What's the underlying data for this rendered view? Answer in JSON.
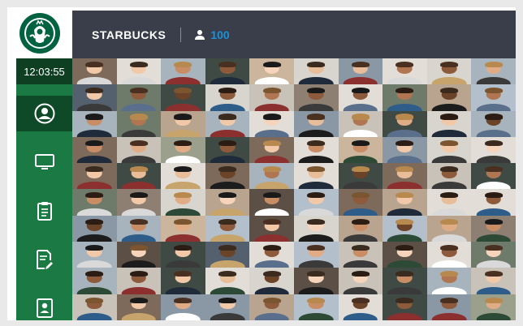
{
  "app": {
    "brand": "STARBUCKS",
    "participant_count": "100",
    "clock": "12:03:55"
  },
  "colors": {
    "sidebar": "#1b7a43",
    "sidebar_dark": "#0e3f23",
    "topbar": "#3a3d4a",
    "accent": "#1e90d6"
  },
  "sidebar": {
    "items": [
      {
        "icon": "user-circle-icon",
        "active": true
      },
      {
        "icon": "monitor-icon",
        "active": false
      },
      {
        "icon": "clipboard-icon",
        "active": false
      },
      {
        "icon": "document-edit-icon",
        "active": false
      },
      {
        "icon": "contact-card-icon",
        "active": false
      }
    ]
  },
  "participants": {
    "rows": 10,
    "columns": 10
  }
}
